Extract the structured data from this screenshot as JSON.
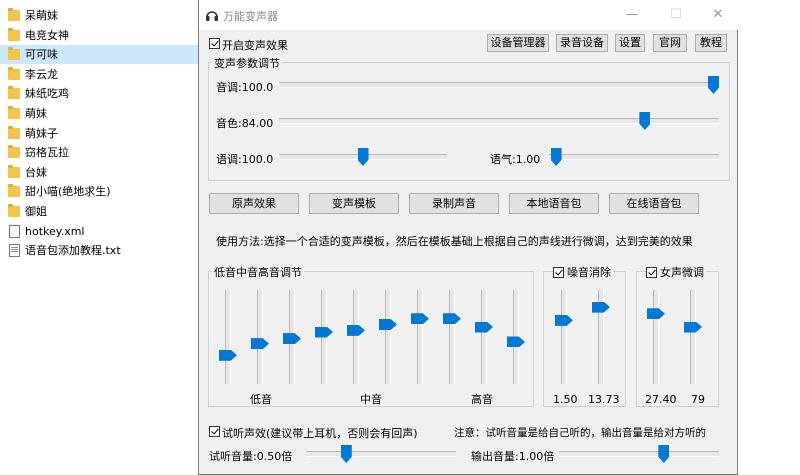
{
  "files": [
    {
      "name": "呆萌妹",
      "type": "folder"
    },
    {
      "name": "电竞女神",
      "type": "folder"
    },
    {
      "name": "可可味",
      "type": "folder",
      "selected": true
    },
    {
      "name": "李云龙",
      "type": "folder"
    },
    {
      "name": "妹纸吃鸡",
      "type": "folder"
    },
    {
      "name": "萌妹",
      "type": "folder"
    },
    {
      "name": "萌妹子",
      "type": "folder"
    },
    {
      "name": "窃格瓦拉",
      "type": "folder"
    },
    {
      "name": "台妹",
      "type": "folder"
    },
    {
      "name": "甜小喵(绝地求生)",
      "type": "folder"
    },
    {
      "name": "御姐",
      "type": "folder"
    },
    {
      "name": "hotkey.xml",
      "type": "file"
    },
    {
      "name": "语音包添加教程.txt",
      "type": "text"
    }
  ],
  "window": {
    "title": "万能变声器",
    "controls": {
      "minimize": "—",
      "maximize": "☐",
      "close": "✕"
    },
    "enable_label": "开启变声效果",
    "enable_checked": true,
    "toolbar": [
      {
        "label": "设备管理器",
        "name": "device-manager-button"
      },
      {
        "label": "录音设备",
        "name": "recording-device-button"
      },
      {
        "label": "设置",
        "name": "settings-button"
      },
      {
        "label": "官网",
        "name": "website-button"
      },
      {
        "label": "教程",
        "name": "tutorial-button"
      }
    ]
  },
  "params": {
    "group_label": "变声参数调节",
    "pitch": {
      "label": "音调:100.0",
      "value": 100.0,
      "min": 0,
      "max": 100
    },
    "timbre": {
      "label": "音色:84.00",
      "value": 84.0,
      "min": 0,
      "max": 100
    },
    "speed": {
      "label": "语调:100.0",
      "value": 100.0,
      "min": 0,
      "max": 200
    },
    "breath": {
      "label": "语气:1.00",
      "value": 1.0,
      "min": 0,
      "max": 100
    }
  },
  "presets": [
    "原声效果",
    "变声模板",
    "录制声音",
    "本地语音包",
    "在线语音包"
  ],
  "usage_text": "使用方法:选择一个合适的变声模板，然后在模板基础上根据自己的声线进行微调，达到完美的效果",
  "eq": {
    "group_label": "低音中音高音调节",
    "levels": [
      0.28,
      0.42,
      0.48,
      0.56,
      0.58,
      0.65,
      0.72,
      0.72,
      0.62,
      0.44
    ],
    "low_label": "低音",
    "mid_label": "中音",
    "high_label": "高音"
  },
  "noise": {
    "label": "噪音消除",
    "checked": true,
    "sliders": [
      {
        "display": "1.50",
        "level": 0.7
      },
      {
        "display": "13.73",
        "level": 0.86
      }
    ]
  },
  "female": {
    "label": "女声微调",
    "checked": true,
    "sliders": [
      {
        "display": "27.40",
        "level": 0.78
      },
      {
        "display": "79",
        "level": 0.62
      }
    ]
  },
  "monitor": {
    "label": "试听声效(建议带上耳机，否则会有回声)",
    "checked": true,
    "note": "注意：试听音量是给自己听的，输出音量是给对方听的",
    "listen_label": "试听音量:0.50倍",
    "listen_value": 0.5,
    "listen_max": 2.0,
    "output_label": "输出音量:1.00倍",
    "output_value": 1.0,
    "output_max": 1.5
  }
}
